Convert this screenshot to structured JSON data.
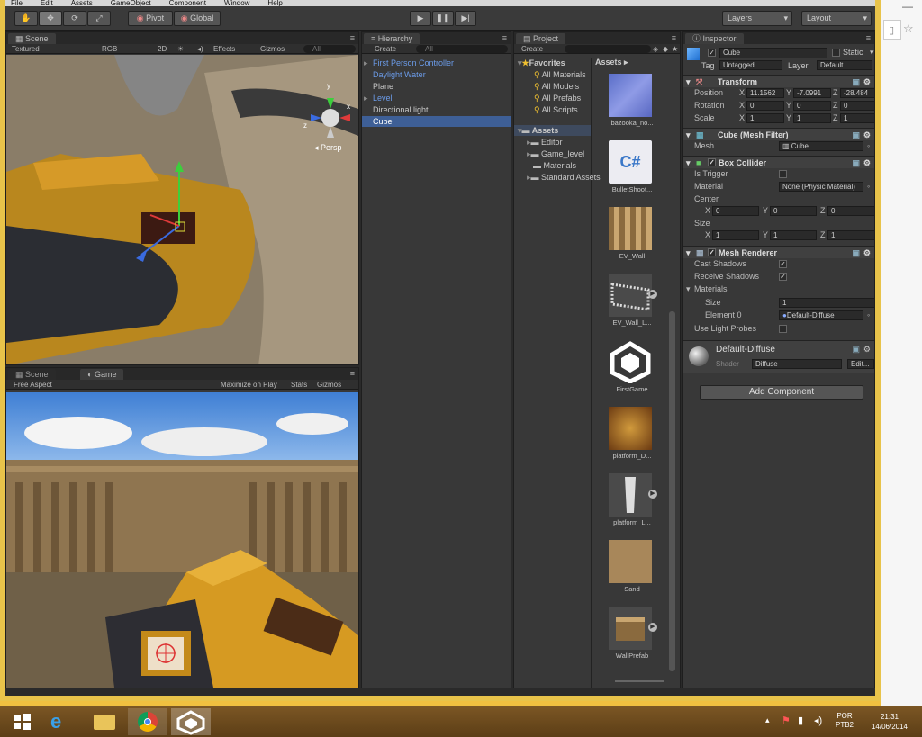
{
  "menu": [
    "File",
    "Edit",
    "Assets",
    "GameObject",
    "Component",
    "Window",
    "Help"
  ],
  "toolbar": {
    "pivot_label": "Pivot",
    "global_label": "Global",
    "layers_label": "Layers",
    "layout_label": "Layout"
  },
  "scene": {
    "tab_label": "Scene",
    "shading": "Textured",
    "render_mode": "RGB",
    "mode_2d": "2D",
    "effects_label": "Effects",
    "gizmos_label": "Gizmos",
    "search_placeholder": "All",
    "persp_label": "Persp",
    "axis_y": "y",
    "axis_x": "x",
    "axis_z": "z"
  },
  "game": {
    "tab_scene": "Scene",
    "tab_game": "Game",
    "aspect": "Free Aspect",
    "maximize_label": "Maximize on Play",
    "stats_label": "Stats",
    "gizmos_label": "Gizmos"
  },
  "hierarchy": {
    "tab_label": "Hierarchy",
    "create_label": "Create",
    "search_placeholder": "All",
    "items": [
      {
        "label": "First Person Controller",
        "prefab": true,
        "arrow": true
      },
      {
        "label": "Daylight Water",
        "prefab": true,
        "arrow": false
      },
      {
        "label": "Plane",
        "prefab": false,
        "arrow": false
      },
      {
        "label": "Level",
        "prefab": true,
        "arrow": true
      },
      {
        "label": "Directional light",
        "prefab": false,
        "arrow": false
      },
      {
        "label": "Cube",
        "prefab": false,
        "arrow": false,
        "selected": true
      }
    ]
  },
  "project": {
    "tab_label": "Project",
    "create_label": "Create",
    "breadcrumb": "Assets",
    "favorites_label": "Favorites",
    "favorites": [
      "All Materials",
      "All Models",
      "All Prefabs",
      "All Scripts"
    ],
    "assets_label": "Assets",
    "folders": [
      "Editor",
      "Game_level",
      "Materials",
      "Standard Assets"
    ],
    "assets": [
      {
        "label": "bazooka_no...",
        "icon": "normal-map-thumbnail"
      },
      {
        "label": "BulletShoot...",
        "icon": "csharp-script-icon"
      },
      {
        "label": "EV_Wall",
        "icon": "wall-texture-thumbnail"
      },
      {
        "label": "EV_Wall_L...",
        "icon": "wall-model-thumbnail"
      },
      {
        "label": "FirstGame",
        "icon": "unity-scene-icon"
      },
      {
        "label": "platform_D...",
        "icon": "platform-texture-thumbnail"
      },
      {
        "label": "platform_L...",
        "icon": "platform-model-thumbnail"
      },
      {
        "label": "Sand",
        "icon": "sand-texture-thumbnail"
      },
      {
        "label": "WallPrefab",
        "icon": "prefab-thumbnail"
      }
    ]
  },
  "inspector": {
    "tab_label": "Inspector",
    "object_name": "Cube",
    "static_label": "Static",
    "tag_label": "Tag",
    "tag_value": "Untagged",
    "layer_label": "Layer",
    "layer_value": "Default",
    "transform": {
      "title": "Transform",
      "position_label": "Position",
      "position": {
        "x": "11.1562",
        "y": "-7.0991",
        "z": "-28.484"
      },
      "rotation_label": "Rotation",
      "rotation": {
        "x": "0",
        "y": "0",
        "z": "0"
      },
      "scale_label": "Scale",
      "scale": {
        "x": "1",
        "y": "1",
        "z": "1"
      }
    },
    "mesh_filter": {
      "title": "Cube (Mesh Filter)",
      "mesh_label": "Mesh",
      "mesh_value": "Cube"
    },
    "box_collider": {
      "title": "Box Collider",
      "is_trigger_label": "Is Trigger",
      "material_label": "Material",
      "material_value": "None (Physic Material)",
      "center_label": "Center",
      "center": {
        "x": "0",
        "y": "0",
        "z": "0"
      },
      "size_label": "Size",
      "size": {
        "x": "1",
        "y": "1",
        "z": "1"
      }
    },
    "mesh_renderer": {
      "title": "Mesh Renderer",
      "cast_shadows_label": "Cast Shadows",
      "receive_shadows_label": "Receive Shadows",
      "materials_label": "Materials",
      "size_label": "Size",
      "size_value": "1",
      "element0_label": "Element 0",
      "element0_value": "Default-Diffuse",
      "light_probes_label": "Use Light Probes"
    },
    "material": {
      "name": "Default-Diffuse",
      "shader_label": "Shader",
      "shader_value": "Diffuse",
      "edit_label": "Edit..."
    },
    "add_component_label": "Add Component"
  },
  "taskbar": {
    "lang": "POR",
    "kbd": "PTB2",
    "time": "21:31",
    "date": "14/06/2014"
  }
}
